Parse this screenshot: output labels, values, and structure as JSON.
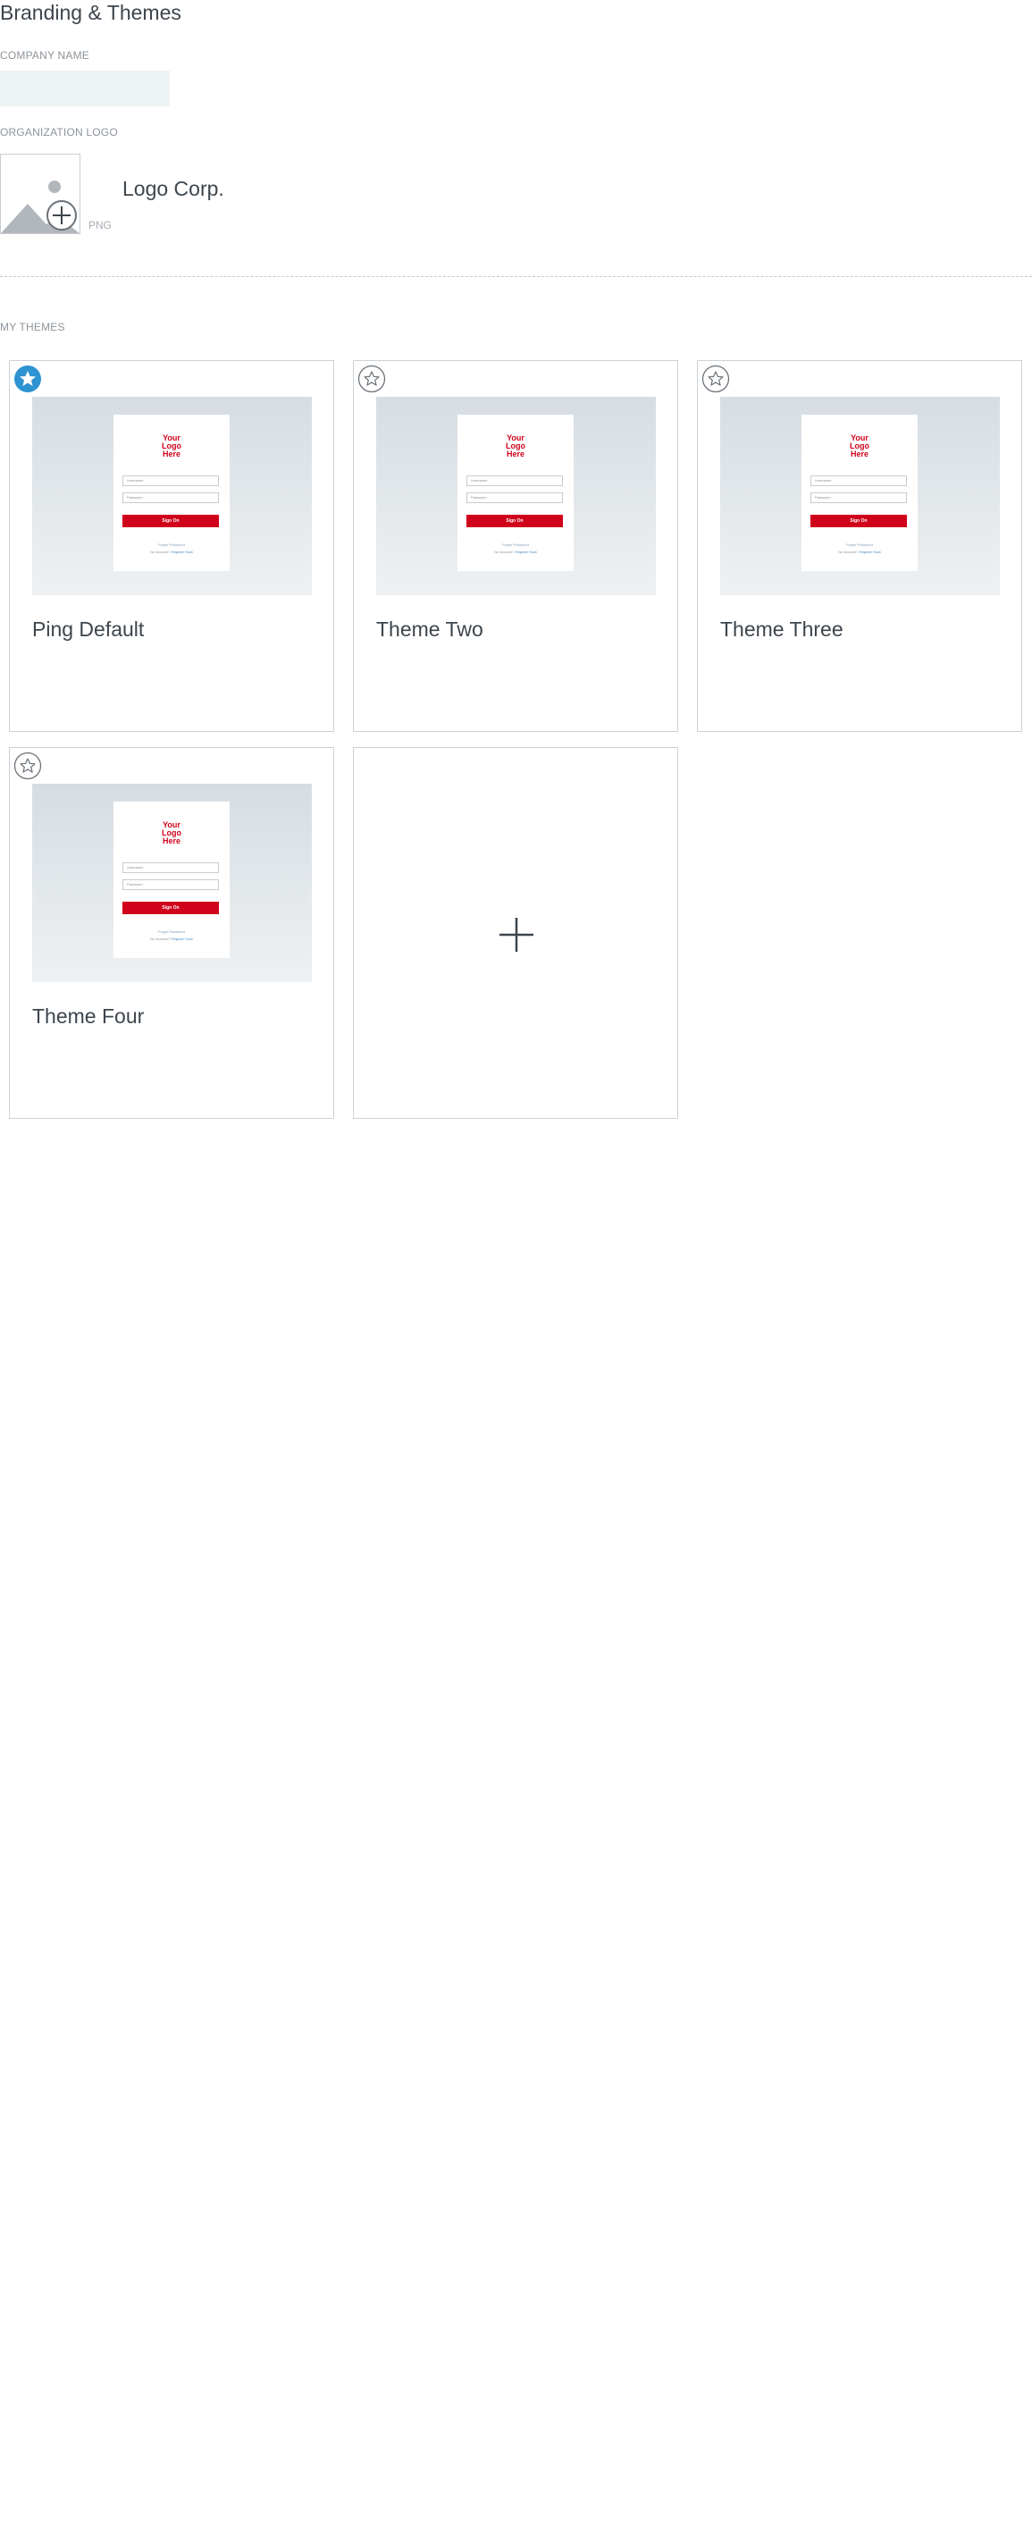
{
  "page": {
    "title": "Branding & Themes"
  },
  "company": {
    "label": "COMPANY NAME",
    "value": "",
    "placeholder": ""
  },
  "logo": {
    "label": "ORGANIZATION LOGO",
    "file_hint": "PNG",
    "name": "Logo Corp.",
    "icon": "image-add-icon"
  },
  "themes": {
    "label": "MY THEMES",
    "accent_color": "#2e93d1",
    "items": [
      {
        "name": "Ping Default",
        "default": true,
        "preview": {
          "logo_text": "Your Logo Here",
          "username": "Username",
          "password": "Password",
          "button": "Sign On",
          "forgot": "Forgot Password",
          "no_account": "No Account?",
          "register": "Register Now"
        }
      },
      {
        "name": "Theme Two",
        "default": false,
        "preview": {
          "logo_text": "Your Logo Here",
          "username": "Username",
          "password": "Password",
          "button": "Sign On",
          "forgot": "Forgot Password",
          "no_account": "No Account?",
          "register": "Register Now"
        }
      },
      {
        "name": "Theme Three",
        "default": false,
        "preview": {
          "logo_text": "Your Logo Here",
          "username": "Username",
          "password": "Password",
          "button": "Sign On",
          "forgot": "Forgot Password",
          "no_account": "No Account?",
          "register": "Register Now"
        }
      },
      {
        "name": "Theme Four",
        "default": false,
        "preview": {
          "logo_text": "Your Logo Here",
          "username": "Username",
          "password": "Password",
          "button": "Sign On",
          "forgot": "Forgot Password",
          "no_account": "No Account?",
          "register": "Register Now"
        }
      }
    ],
    "add_icon": "plus-icon",
    "preview_button_color": "#d0021b"
  }
}
